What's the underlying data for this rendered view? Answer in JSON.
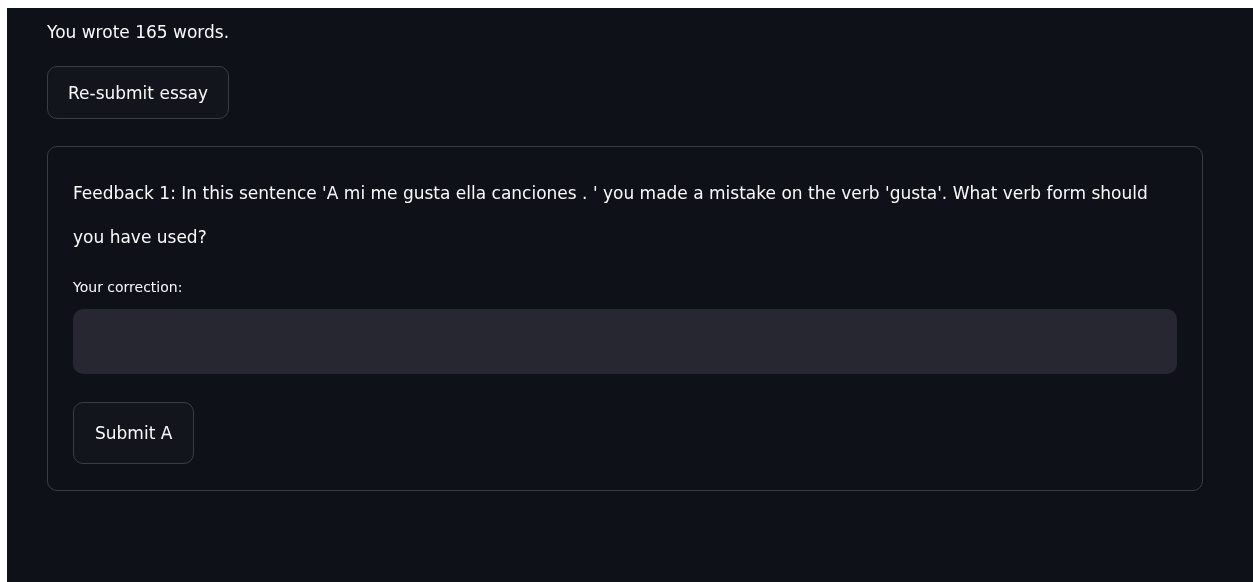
{
  "word_count": "You wrote 165 words.",
  "resubmit_button": "Re-submit essay",
  "feedback": {
    "question": "Feedback 1: In this sentence 'A mi me gusta ella canciones . ' you made a mistake on the verb 'gusta'. What verb form should you have used?",
    "field_label": "Your correction:",
    "submit_button": "Submit A"
  }
}
